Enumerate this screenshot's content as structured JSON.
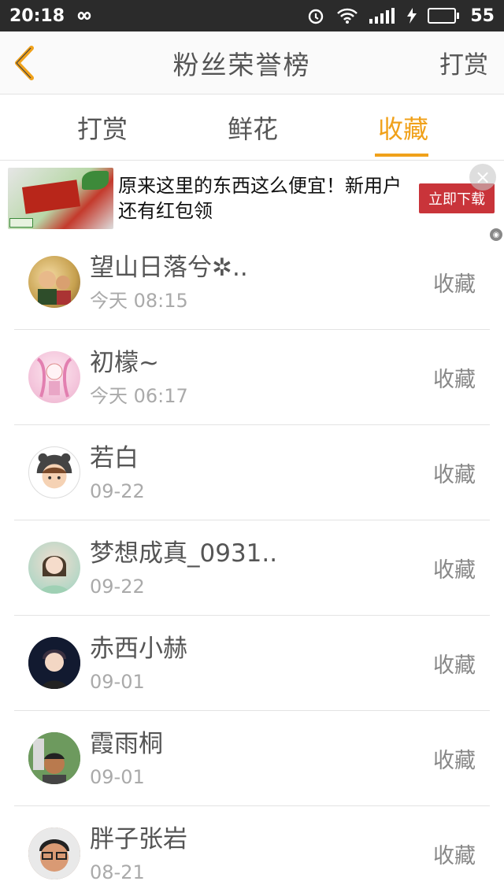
{
  "status": {
    "time": "20:18",
    "battery": "55",
    "battery_level": 0.55,
    "icons": [
      "infinity-icon",
      "alarm-icon",
      "wifi-icon",
      "signal-icon",
      "charging-icon",
      "battery-icon"
    ]
  },
  "header": {
    "title": "粉丝荣誉榜",
    "action": "打赏"
  },
  "tabs": [
    {
      "label": "打赏",
      "active": false
    },
    {
      "label": "鲜花",
      "active": false
    },
    {
      "label": "收藏",
      "active": true
    }
  ],
  "ad": {
    "text": "原来这里的东西这么便宜！新用户还有红包领",
    "button": "立即下载",
    "close": "×"
  },
  "list": [
    {
      "name": "望山日落兮✲..",
      "time": "今天 08:15",
      "action": "收藏"
    },
    {
      "name": "初檬~",
      "time": "今天 06:17",
      "action": "收藏"
    },
    {
      "name": "若白",
      "time": "09-22",
      "action": "收藏"
    },
    {
      "name": "梦想成真_0931..",
      "time": "09-22",
      "action": "收藏"
    },
    {
      "name": "赤西小赫",
      "time": "09-01",
      "action": "收藏"
    },
    {
      "name": "霞雨桐",
      "time": "09-01",
      "action": "收藏"
    },
    {
      "name": "胖子张岩",
      "time": "08-21",
      "action": "收藏"
    }
  ],
  "colors": {
    "accent": "#f0a11a",
    "ad_button": "#c9343a",
    "statusbar": "#2b2b2b"
  }
}
